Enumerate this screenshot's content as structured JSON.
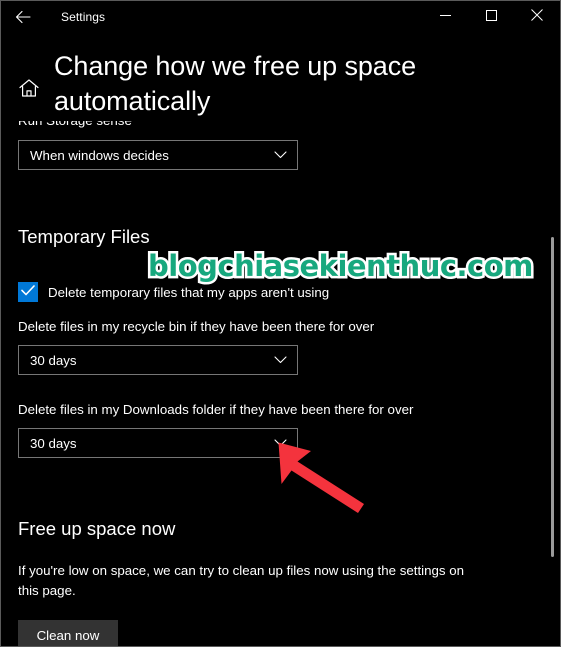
{
  "window": {
    "app_title": "Settings",
    "back_icon": "back-arrow-icon",
    "minimize_label": "Minimize",
    "maximize_label": "Maximize",
    "close_label": "Close"
  },
  "header": {
    "home_icon": "home-icon",
    "page_title": "Change how we free up space automatically"
  },
  "storage_sense": {
    "label": "Run Storage sense",
    "dropdown": {
      "name": "run-storage-sense-dropdown",
      "value": "When windows decides",
      "chevron_icon": "chevron-down-icon"
    }
  },
  "temporary_files": {
    "heading": "Temporary Files",
    "checkbox": {
      "label": "Delete temporary files that my apps aren't using",
      "checked": true,
      "check_icon": "checkmark-icon"
    },
    "recycle_bin": {
      "label": "Delete files in my recycle bin if they have been there for over",
      "dropdown": {
        "name": "recycle-bin-retention-dropdown",
        "value": "30 days",
        "chevron_icon": "chevron-down-icon"
      }
    },
    "downloads": {
      "label": "Delete files in my Downloads folder if they have been there for over",
      "dropdown": {
        "name": "downloads-retention-dropdown",
        "value": "30 days",
        "chevron_icon": "chevron-down-icon"
      }
    }
  },
  "free_up_space": {
    "heading": "Free up space now",
    "description": "If you're low on space, we can try to clean up files now using the settings on this page.",
    "button_label": "Clean now"
  },
  "annotations": {
    "watermark_text": "blogchiasekienthuc.com",
    "watermark_color": "#17a87e",
    "watermark_outline_color": "#ffffff",
    "arrow_color": "#f4333d",
    "arrow_target": "downloads-retention-dropdown"
  },
  "colors": {
    "background": "#000000",
    "text": "#ffffff",
    "accent": "#0078d7",
    "control_border": "#767676",
    "button_face": "#333333",
    "scrollbar_thumb": "#9b9b9b",
    "window_border": "#5a5a5a"
  }
}
